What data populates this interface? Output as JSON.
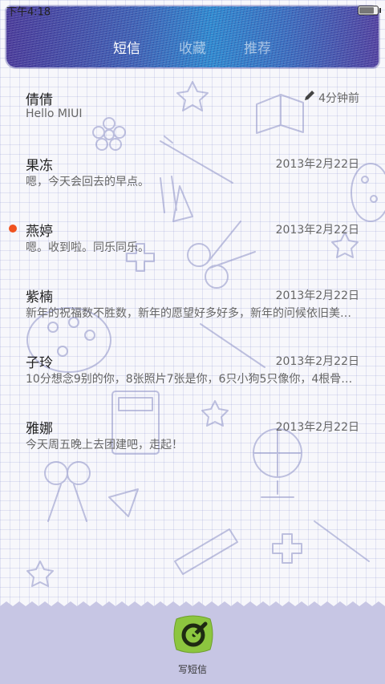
{
  "status_bar": {
    "time": "下午4:18",
    "battery_level": 0.8
  },
  "tabs": [
    {
      "label": "短信",
      "active": true
    },
    {
      "label": "收藏",
      "active": false
    },
    {
      "label": "推荐",
      "active": false
    }
  ],
  "conversations": [
    {
      "name": "倩倩",
      "time": "4分钟前",
      "preview": "Hello MIUI",
      "unread": false,
      "draft": true
    },
    {
      "name": "果冻",
      "time": "2013年2月22日",
      "preview": "嗯，今天会回去的早点。",
      "unread": false,
      "draft": false
    },
    {
      "name": "燕婷",
      "time": "2013年2月22日",
      "preview": "嗯。收到啦。同乐同乐。",
      "unread": true,
      "draft": false
    },
    {
      "name": "紫楠",
      "time": "2013年2月22日",
      "preview": "新年的祝福数不胜数，新年的愿望好多好多，新年的问候依旧美好…",
      "unread": false,
      "draft": false
    },
    {
      "name": "子玲",
      "time": "2013年2月22日",
      "preview": "10分想念9别的你，8张照片7张是你，6只小狗5只像你，4根骨头…",
      "unread": false,
      "draft": false
    },
    {
      "name": "雅娜",
      "time": "2013年2月22日",
      "preview": "今天周五晚上去团建吧，走起！",
      "unread": false,
      "draft": false
    }
  ],
  "compose": {
    "label": "写短信",
    "icon": "compose-icon"
  },
  "colors": {
    "accent_green": "#8cc63f",
    "unread_dot": "#f0521f",
    "bottom_bar": "#c7c6e4"
  }
}
